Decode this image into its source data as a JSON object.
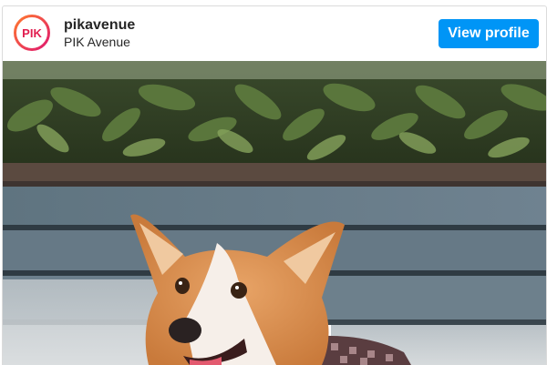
{
  "profile": {
    "username": "pikavenue",
    "full_name": "PIK Avenue",
    "avatar_text": "PIK",
    "avatar_icon": "pik-avenue-logo-icon"
  },
  "actions": {
    "view_profile_label": "View profile"
  },
  "colors": {
    "button_bg": "#0095f6",
    "logo_gradient_start": "#ff6a3d",
    "logo_gradient_end": "#e11d74"
  },
  "post": {
    "image_icon": "corgi-photo"
  }
}
